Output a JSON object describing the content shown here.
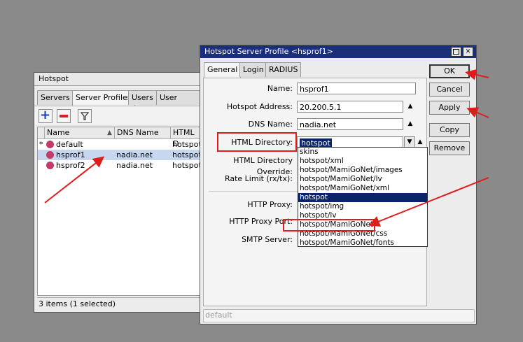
{
  "hotspot_window": {
    "title": "Hotspot",
    "tabs": [
      "Servers",
      "Server Profiles",
      "Users",
      "User Profiles"
    ],
    "columns": [
      "Name",
      "DNS Name",
      "HTML D"
    ],
    "rows": [
      {
        "flag": "*",
        "name": "default",
        "dns": "",
        "html": "hotspot"
      },
      {
        "flag": "",
        "name": "hsprof1",
        "dns": "nadia.net",
        "html": "hotspot"
      },
      {
        "flag": "",
        "name": "hsprof2",
        "dns": "nadia.net",
        "html": "hotspot"
      }
    ],
    "status": "3 items (1 selected)"
  },
  "profile_dialog": {
    "title": "Hotspot Server Profile <hsprof1>",
    "tabs": [
      "General",
      "Login",
      "RADIUS"
    ],
    "fields": {
      "name_label": "Name:",
      "name_value": "hsprof1",
      "address_label": "Hotspot Address:",
      "address_value": "20.200.5.1",
      "dns_label": "DNS Name:",
      "dns_value": "nadia.net",
      "htmldir_label": "HTML Directory:",
      "htmldir_value": "hotspot",
      "override_label": "HTML Directory Override:",
      "ratelimit_label": "Rate Limit (rx/tx):",
      "proxy_label": "HTTP Proxy:",
      "proxyport_label": "HTTP Proxy Port:",
      "smtp_label": "SMTP Server:"
    },
    "buttons": {
      "ok": "OK",
      "cancel": "Cancel",
      "apply": "Apply",
      "copy": "Copy",
      "remove": "Remove"
    },
    "dropdown_options": [
      "skins",
      "hotspot/xml",
      "hotspot/MamiGoNet/images",
      "hotspot/MamiGoNet/lv",
      "hotspot/MamiGoNet/xml",
      "hotspot",
      "hotspot/img",
      "hotspot/lv",
      "hotspot/MamiGoNet",
      "hotspot/MamiGoNet/css",
      "hotspot/MamiGoNet/fonts"
    ],
    "dropdown_highlighted": "hotspot",
    "status": "default"
  },
  "colors": {
    "titlebar": "#1b2e7a",
    "highlight": "#0a246a",
    "annotation": "#e01c1c",
    "selected_row": "#c6d7ef"
  }
}
